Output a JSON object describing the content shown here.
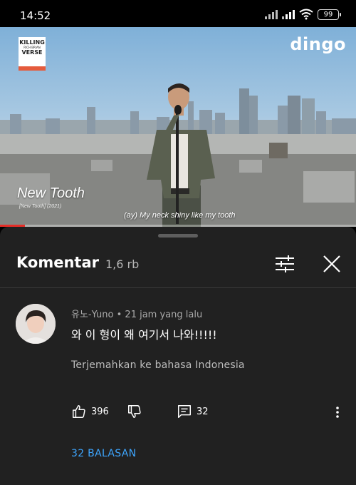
{
  "status_bar": {
    "time": "14:52",
    "battery": "99"
  },
  "video": {
    "show_logo": {
      "line1": "KILLING",
      "line2": "RICH BRIAN",
      "line3": "VERSE"
    },
    "channel": "dingo",
    "song_title": "New Tooth",
    "song_subtitle": "[New Tooth] (2021)",
    "caption": "(ay) My neck shiny like my tooth",
    "progress": 0.07
  },
  "comments_panel": {
    "title": "Komentar",
    "count": "1,6 rb",
    "icons": {
      "filter": "filter-sliders-icon",
      "close": "close-icon"
    }
  },
  "comment": {
    "meta": "유노-Yuno • 21 jam yang lalu",
    "text": "와 이 형이 왜 여기서 나와!!!!!",
    "translate_label": "Terjemahkan ke bahasa Indonesia",
    "likes": "396",
    "reply_count": "32",
    "replies_label": "32 BALASAN"
  },
  "colors": {
    "sheet_bg": "#212121",
    "link_blue": "#3ea6ff",
    "progress_red": "#e52d27"
  }
}
